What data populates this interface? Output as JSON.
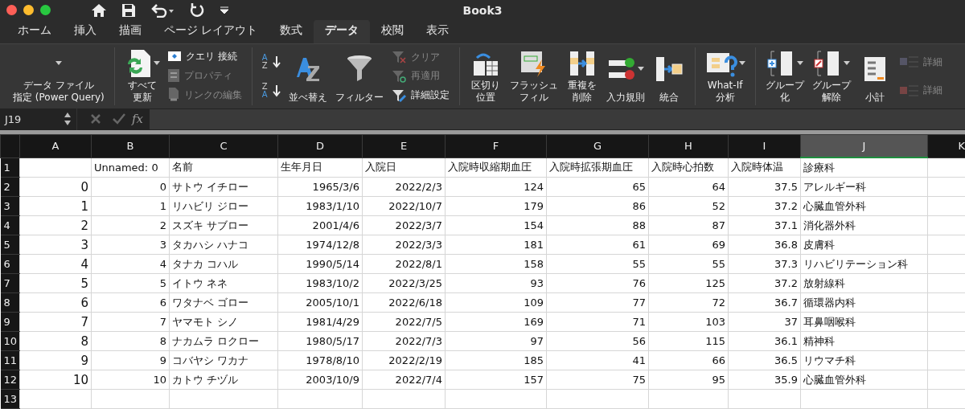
{
  "window": {
    "title": "Book3"
  },
  "tabs": [
    {
      "label": "ホーム",
      "selected": false
    },
    {
      "label": "挿入",
      "selected": false
    },
    {
      "label": "描画",
      "selected": false
    },
    {
      "label": "ページ レイアウト",
      "selected": false
    },
    {
      "label": "数式",
      "selected": false
    },
    {
      "label": "データ",
      "selected": true
    },
    {
      "label": "校閲",
      "selected": false
    },
    {
      "label": "表示",
      "selected": false
    }
  ],
  "ribbon": [
    {
      "items": [
        {
          "kind": "large",
          "lines": [
            "データ ファイル",
            "指定 (Power Query)"
          ],
          "caret": true
        }
      ]
    },
    {
      "items": [
        {
          "kind": "large",
          "lines": [
            "すべて",
            "更新"
          ],
          "caret": true
        },
        {
          "kind": "stack",
          "items": [
            {
              "label": "クエリ 接続",
              "disabled": false
            },
            {
              "label": "プロパティ",
              "disabled": true
            },
            {
              "label": "リンクの編集",
              "disabled": true
            }
          ]
        }
      ]
    },
    {
      "items": [
        {
          "kind": "stack",
          "items": [
            {
              "letters": [
                "A",
                "Z"
              ]
            },
            {
              "letters": [
                "Z",
                "A"
              ]
            }
          ]
        },
        {
          "kind": "large",
          "lines": [
            "並べ替え"
          ],
          "caret": false
        },
        {
          "kind": "large",
          "lines": [
            "フィルター"
          ],
          "caret": false
        },
        {
          "kind": "stack",
          "items": [
            {
              "label": "クリア",
              "disabled": true
            },
            {
              "label": "再適用",
              "disabled": true
            },
            {
              "label": "詳細設定",
              "disabled": false
            }
          ]
        }
      ]
    },
    {
      "items": [
        {
          "kind": "large",
          "lines": [
            "区切り",
            "位置"
          ],
          "caret": false
        },
        {
          "kind": "large",
          "lines": [
            "フラッシュ",
            "フィル"
          ],
          "caret": false
        },
        {
          "kind": "large",
          "lines": [
            "重複を",
            "削除"
          ],
          "caret": false
        },
        {
          "kind": "large",
          "lines": [
            "入力規則"
          ],
          "caret": true
        },
        {
          "kind": "large",
          "lines": [
            "統合"
          ],
          "caret": false
        }
      ]
    },
    {
      "items": [
        {
          "kind": "large",
          "lines": [
            "What-If",
            "分析"
          ],
          "caret": true
        }
      ]
    },
    {
      "items": [
        {
          "kind": "large",
          "lines": [
            "グループ",
            "化"
          ],
          "caret": true
        },
        {
          "kind": "large",
          "lines": [
            "グループ",
            "解除"
          ],
          "caret": true
        },
        {
          "kind": "large",
          "lines": [
            "小計"
          ],
          "caret": false
        },
        {
          "kind": "stack",
          "items": [
            {
              "label": "詳細",
              "disabled": true
            },
            {
              "label": "詳細",
              "disabled": true
            }
          ]
        }
      ]
    }
  ],
  "formula_bar": {
    "cell_ref": "J19",
    "function_label": "fx"
  },
  "sheet": {
    "columns": [
      {
        "label": "A",
        "selected": false
      },
      {
        "label": "B",
        "selected": false
      },
      {
        "label": "C",
        "selected": false
      },
      {
        "label": "D",
        "selected": false
      },
      {
        "label": "E",
        "selected": false
      },
      {
        "label": "F",
        "selected": false
      },
      {
        "label": "G",
        "selected": false
      },
      {
        "label": "H",
        "selected": false
      },
      {
        "label": "I",
        "selected": false
      },
      {
        "label": "J",
        "selected": true
      },
      {
        "label": "K",
        "selected": false
      }
    ],
    "rows": [
      {
        "number": "1",
        "cells": [
          "",
          "Unnamed: 0",
          "名前",
          "生年月日",
          "入院日",
          "入院時収縮期血圧",
          "入院時拡張期血圧",
          "入院時心拍数",
          "入院時体温",
          "診療科",
          ""
        ]
      },
      {
        "number": "2",
        "cells": [
          "0",
          "0",
          "サトウ イチロー",
          "1965/3/6",
          "2022/2/3",
          "124",
          "65",
          "64",
          "37.5",
          "アレルギー科",
          ""
        ]
      },
      {
        "number": "3",
        "cells": [
          "1",
          "1",
          "リハビリ ジロー",
          "1983/1/10",
          "2022/10/7",
          "179",
          "86",
          "52",
          "37.2",
          "心臓血管外科",
          ""
        ]
      },
      {
        "number": "4",
        "cells": [
          "2",
          "2",
          "スズキ サブロー",
          "2001/4/6",
          "2022/3/7",
          "154",
          "88",
          "87",
          "37.1",
          "消化器外科",
          ""
        ]
      },
      {
        "number": "5",
        "cells": [
          "3",
          "3",
          "タカハシ ハナコ",
          "1974/12/8",
          "2022/3/3",
          "181",
          "61",
          "69",
          "36.8",
          "皮膚科",
          ""
        ]
      },
      {
        "number": "6",
        "cells": [
          "4",
          "4",
          "タナカ コハル",
          "1990/5/14",
          "2022/8/1",
          "158",
          "55",
          "55",
          "37.3",
          "リハビリテーション科",
          ""
        ]
      },
      {
        "number": "7",
        "cells": [
          "5",
          "5",
          "イトウ ネネ",
          "1983/10/2",
          "2022/3/25",
          "93",
          "76",
          "125",
          "37.2",
          "放射線科",
          ""
        ]
      },
      {
        "number": "8",
        "cells": [
          "6",
          "6",
          "ワタナベ ゴロー",
          "2005/10/1",
          "2022/6/18",
          "109",
          "77",
          "72",
          "36.7",
          "循環器内科",
          ""
        ]
      },
      {
        "number": "9",
        "cells": [
          "7",
          "7",
          "ヤマモト シノ",
          "1981/4/29",
          "2022/7/5",
          "169",
          "71",
          "103",
          "37",
          "耳鼻咽喉科",
          ""
        ]
      },
      {
        "number": "10",
        "cells": [
          "8",
          "8",
          "ナカムラ ロクロー",
          "1980/5/17",
          "2022/7/3",
          "97",
          "56",
          "115",
          "36.1",
          "精神科",
          ""
        ]
      },
      {
        "number": "11",
        "cells": [
          "9",
          "9",
          "コバヤシ ワカナ",
          "1978/8/10",
          "2022/2/19",
          "185",
          "41",
          "66",
          "36.5",
          "リウマチ科",
          ""
        ]
      },
      {
        "number": "12",
        "cells": [
          "10",
          "10",
          "カトウ チヅル",
          "2003/10/9",
          "2022/7/4",
          "157",
          "75",
          "95",
          "35.9",
          "心臓血管外科",
          ""
        ]
      },
      {
        "number": "13",
        "cells": [
          "",
          "",
          "",
          "",
          "",
          "",
          "",
          "",
          "",
          "",
          ""
        ]
      }
    ]
  }
}
